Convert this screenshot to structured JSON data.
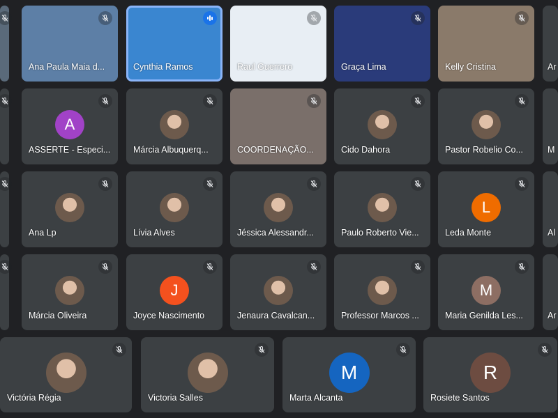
{
  "rows": [
    [
      {
        "name": "",
        "type": "video"
      },
      {
        "name": "Ana Paula Maia d...",
        "type": "video",
        "bg": "#5d7fa6"
      },
      {
        "name": "Cynthia Ramos",
        "type": "video",
        "bg": "#3a86d0",
        "speaking": true
      },
      {
        "name": "Raul Guerrero",
        "type": "video",
        "bg": "#e8eef4"
      },
      {
        "name": "Graça Lima",
        "type": "video",
        "bg": "#2a3b7a"
      },
      {
        "name": "Kelly Cristina",
        "type": "video",
        "bg": "#8a7a6a"
      },
      {
        "name": "Ar",
        "type": "blank"
      }
    ],
    [
      {
        "name": "",
        "type": "blank"
      },
      {
        "name": "ASSERTE - Especi...",
        "type": "letter",
        "letter": "A",
        "color": "#a142c7"
      },
      {
        "name": "Márcia Albuquerq...",
        "type": "photo"
      },
      {
        "name": "COORDENAÇÃO...",
        "type": "video",
        "bg": "#7a6f6a"
      },
      {
        "name": "Cido Dahora",
        "type": "photo"
      },
      {
        "name": "Pastor Robelio Co...",
        "type": "photo"
      },
      {
        "name": "M",
        "type": "blank"
      }
    ],
    [
      {
        "name": "",
        "type": "blank"
      },
      {
        "name": "Ana Lp",
        "type": "photo"
      },
      {
        "name": "Lívia Alves",
        "type": "photo"
      },
      {
        "name": "Jéssica Alessandr...",
        "type": "photo"
      },
      {
        "name": "Paulo Roberto Vie...",
        "type": "photo"
      },
      {
        "name": "Leda Monte",
        "type": "letter",
        "letter": "L",
        "color": "#ef6c00"
      },
      {
        "name": "Al",
        "type": "blank"
      }
    ],
    [
      {
        "name": "",
        "type": "blank"
      },
      {
        "name": "Márcia Oliveira",
        "type": "photo"
      },
      {
        "name": "Joyce Nascimento",
        "type": "letter",
        "letter": "J",
        "color": "#f4511e"
      },
      {
        "name": "Jenaura Cavalcan...",
        "type": "photo"
      },
      {
        "name": "Professor Marcos ...",
        "type": "photo"
      },
      {
        "name": "Maria Genilda Les...",
        "type": "letter",
        "letter": "M",
        "color": "#8d6e63"
      },
      {
        "name": "Ar",
        "type": "blank"
      }
    ]
  ],
  "bottom_row": [
    {
      "name": "Victória Régia",
      "type": "photo"
    },
    {
      "name": "Victoria Salles",
      "type": "photo"
    },
    {
      "name": "Marta Alcanta",
      "type": "letter",
      "letter": "M",
      "color": "#1565c0"
    },
    {
      "name": "Rosiete Santos",
      "type": "letter",
      "letter": "R",
      "color": "#6d4c41"
    }
  ],
  "colors": {
    "background": "#202124",
    "tile": "#3c4043",
    "speaking": "#1a73e8"
  },
  "icons": {
    "muted": "mic-off-icon",
    "speaking": "audio-level-icon"
  }
}
